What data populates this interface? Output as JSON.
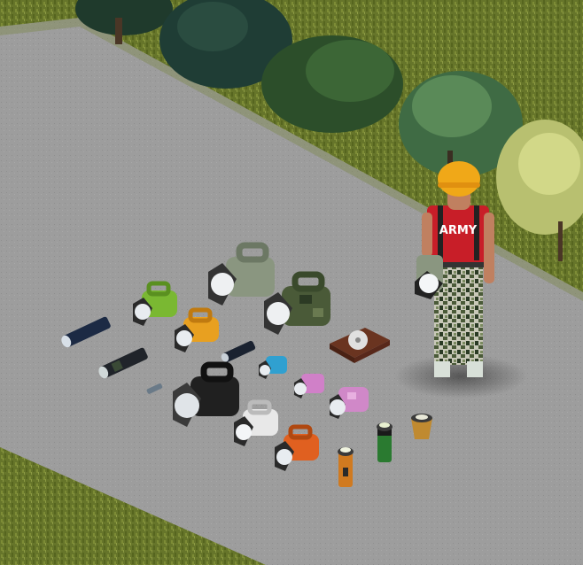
{
  "scene": {
    "type": "isometric-game-world",
    "palette": {
      "grass": "#6b7a2a",
      "grass_dark": "#4e5c1e",
      "road": "#9c9c9c",
      "road_dark": "#8a8a8a",
      "tree_dark": "#1f3a2c",
      "tree": "#2f5a34",
      "tree_light": "#4e7d4a",
      "bush_yellow": "#c9cf7a"
    }
  },
  "character": {
    "helmet_color": "#f0a818",
    "shirt_color": "#c81e28",
    "shirt_text": "ARMY",
    "pants_pattern": "camo",
    "held_item": "lantern-flashlight"
  },
  "items": [
    {
      "kind": "flashlight-small",
      "color": "#1c2a44",
      "name": "flashlight-navy"
    },
    {
      "kind": "flashlight-small",
      "color": "#20242a",
      "name": "flashlight-camo-dark"
    },
    {
      "kind": "penlight",
      "color": "#6a7a88",
      "name": "penlight"
    },
    {
      "kind": "flashlight-small",
      "color": "#1a2230",
      "name": "flashlight-black"
    },
    {
      "kind": "lantern",
      "color": "#7ab832",
      "name": "lantern-green"
    },
    {
      "kind": "lantern",
      "color": "#e8a020",
      "name": "lantern-orange"
    },
    {
      "kind": "lantern-large",
      "color": "#8a9680",
      "name": "lantern-large-gray"
    },
    {
      "kind": "lantern-large",
      "color": "#4a5a38",
      "name": "lantern-large-camo"
    },
    {
      "kind": "lantern-large",
      "color": "#202020",
      "name": "lantern-large-black"
    },
    {
      "kind": "lantern",
      "color": "#30a0d0",
      "name": "lantern-blue"
    },
    {
      "kind": "lantern",
      "color": "#d080c8",
      "name": "lantern-pink"
    },
    {
      "kind": "lantern",
      "color": "#d088c8",
      "name": "lantern-pink-camo"
    },
    {
      "kind": "lantern",
      "color": "#e8e8e8",
      "name": "lantern-white"
    },
    {
      "kind": "lantern",
      "color": "#e06020",
      "name": "lantern-orange-red"
    },
    {
      "kind": "hand-crank-radio",
      "color": "#6a3420",
      "name": "crank-device"
    },
    {
      "kind": "torch-upright",
      "color": "#d07a20",
      "name": "torch-orange"
    },
    {
      "kind": "torch-upright",
      "color": "#2a7a30",
      "name": "torch-green"
    },
    {
      "kind": "candle-jar",
      "color": "#c08a30",
      "name": "candle-lantern"
    }
  ]
}
